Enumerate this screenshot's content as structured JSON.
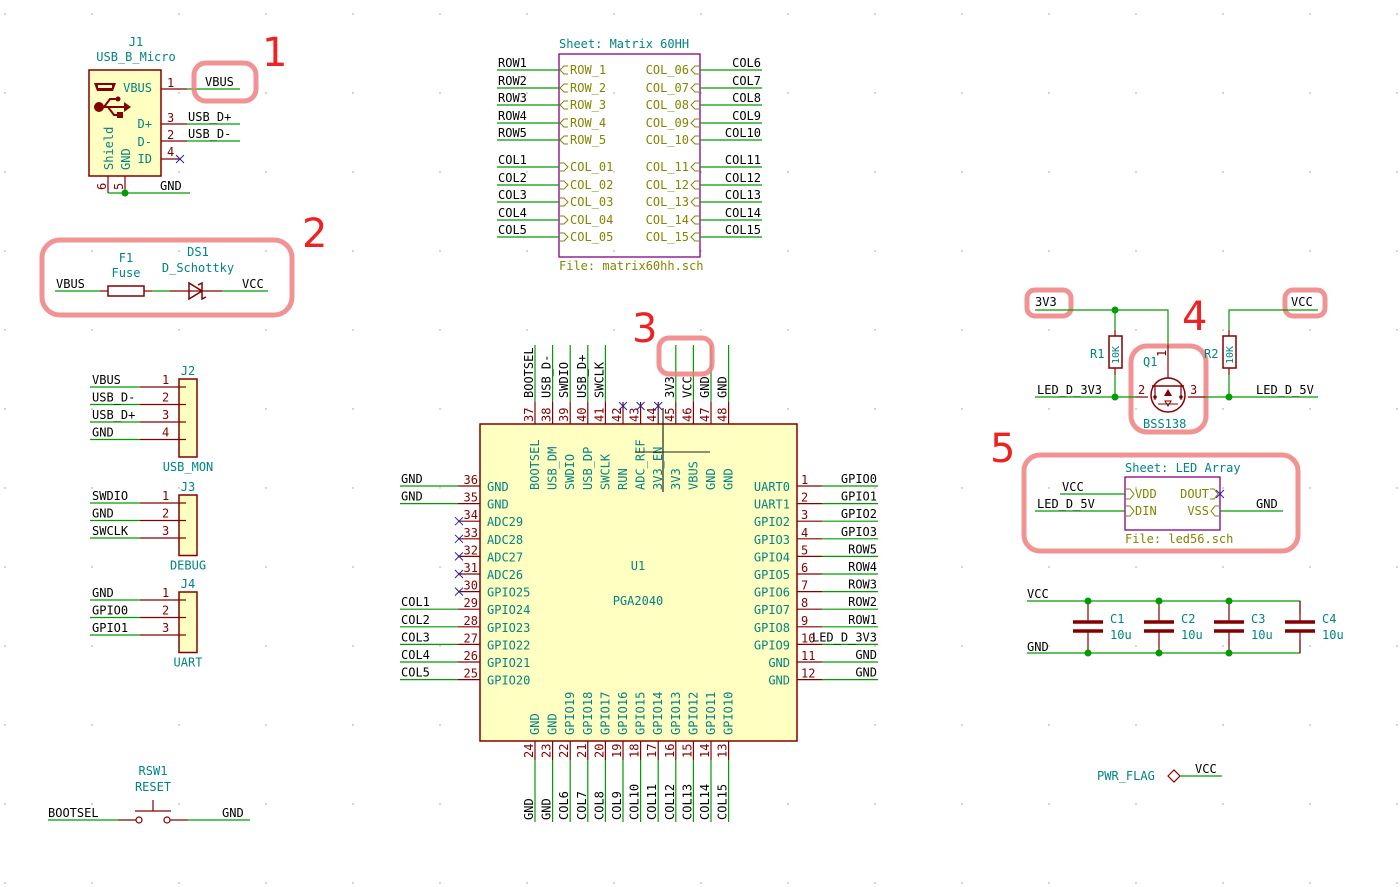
{
  "colors": {
    "wire": "#009c00",
    "component_outline": "#840000",
    "component_fill": "#ffffc2",
    "reference_text": "#008484",
    "sheet_outline": "#840084",
    "sheet_text": "#848400",
    "annotation": "#ee2222",
    "highlight": "#f08080",
    "no_connect": "#2222aa"
  },
  "annotations": [
    "1",
    "2",
    "3",
    "4",
    "5"
  ],
  "j1": {
    "ref": "J1",
    "value": "USB_B_Micro",
    "pins": [
      {
        "num": "1",
        "name": "VBUS",
        "net": "VBUS"
      },
      {
        "num": "3",
        "name": "D+",
        "net": "USB_D+"
      },
      {
        "num": "2",
        "name": "D-",
        "net": "USB_D-"
      },
      {
        "num": "4",
        "name": "ID",
        "net": ""
      }
    ],
    "shield_label": "Shield",
    "gnd_label": "GND",
    "bottom_pins": [
      "6",
      "5"
    ],
    "gnd_net": "GND",
    "icons": [
      "usb-connector-icon",
      "usb-symbol-icon"
    ]
  },
  "power_path": {
    "left_net": "VBUS",
    "right_net": "VCC",
    "fuse": {
      "ref": "F1",
      "value": "Fuse"
    },
    "diode": {
      "ref": "DS1",
      "value": "D_Schottky"
    }
  },
  "matrix_sheet": {
    "title": "Sheet: Matrix 60HH",
    "file": "File: matrix60hh.sch",
    "left_pins": [
      {
        "net": "ROW1",
        "pin": "ROW_1"
      },
      {
        "net": "ROW2",
        "pin": "ROW_2"
      },
      {
        "net": "ROW3",
        "pin": "ROW_3"
      },
      {
        "net": "ROW4",
        "pin": "ROW_4"
      },
      {
        "net": "ROW5",
        "pin": "ROW_5"
      },
      {
        "net": "COL1",
        "pin": "COL_01"
      },
      {
        "net": "COL2",
        "pin": "COL_02"
      },
      {
        "net": "COL3",
        "pin": "COL_03"
      },
      {
        "net": "COL4",
        "pin": "COL_04"
      },
      {
        "net": "COL5",
        "pin": "COL_05"
      }
    ],
    "right_pins": [
      {
        "net": "COL6",
        "pin": "COL_06"
      },
      {
        "net": "COL7",
        "pin": "COL_07"
      },
      {
        "net": "COL8",
        "pin": "COL_08"
      },
      {
        "net": "COL9",
        "pin": "COL_09"
      },
      {
        "net": "COL10",
        "pin": "COL_10"
      },
      {
        "net": "COL11",
        "pin": "COL_11"
      },
      {
        "net": "COL12",
        "pin": "COL_12"
      },
      {
        "net": "COL13",
        "pin": "COL_13"
      },
      {
        "net": "COL14",
        "pin": "COL_14"
      },
      {
        "net": "COL15",
        "pin": "COL_15"
      }
    ]
  },
  "connectors": [
    {
      "ref": "J2",
      "value": "USB_MON",
      "pins": [
        {
          "num": "1",
          "net": "VBUS"
        },
        {
          "num": "2",
          "net": "USB_D-"
        },
        {
          "num": "3",
          "net": "USB_D+"
        },
        {
          "num": "4",
          "net": "GND"
        }
      ]
    },
    {
      "ref": "J3",
      "value": "DEBUG",
      "pins": [
        {
          "num": "1",
          "net": "SWDIO"
        },
        {
          "num": "2",
          "net": "GND"
        },
        {
          "num": "3",
          "net": "SWCLK"
        }
      ]
    },
    {
      "ref": "J4",
      "value": "UART",
      "pins": [
        {
          "num": "1",
          "net": "GND"
        },
        {
          "num": "2",
          "net": "GPIO0"
        },
        {
          "num": "3",
          "net": "GPIO1"
        }
      ]
    }
  ],
  "u1": {
    "ref": "U1",
    "value": "PGA2040",
    "top_pins": [
      {
        "num": "37",
        "name": "BOOTSEL",
        "net": "BOOTSEL"
      },
      {
        "num": "38",
        "name": "USB_DM",
        "net": "USB_D-"
      },
      {
        "num": "39",
        "name": "SWDIO",
        "net": "SWDIO"
      },
      {
        "num": "40",
        "name": "USB_DP",
        "net": "USB_D+"
      },
      {
        "num": "41",
        "name": "SWCLK",
        "net": "SWCLK"
      },
      {
        "num": "42",
        "name": "RUN",
        "net": ""
      },
      {
        "num": "43",
        "name": "ADC_REF",
        "net": ""
      },
      {
        "num": "44",
        "name": "3V3_EN",
        "net": ""
      },
      {
        "num": "45",
        "name": "3V3",
        "net": "3V3"
      },
      {
        "num": "46",
        "name": "VBUS",
        "net": "VCC"
      },
      {
        "num": "47",
        "name": "GND",
        "net": "GND"
      },
      {
        "num": "48",
        "name": "GND",
        "net": "GND"
      }
    ],
    "left_pins": [
      {
        "num": "36",
        "name": "GND",
        "net": "GND"
      },
      {
        "num": "35",
        "name": "GND",
        "net": "GND"
      },
      {
        "num": "34",
        "name": "ADC29",
        "net": ""
      },
      {
        "num": "33",
        "name": "ADC28",
        "net": ""
      },
      {
        "num": "32",
        "name": "ADC27",
        "net": ""
      },
      {
        "num": "31",
        "name": "ADC26",
        "net": ""
      },
      {
        "num": "30",
        "name": "GPIO25",
        "net": ""
      },
      {
        "num": "29",
        "name": "GPIO24",
        "net": "COL1"
      },
      {
        "num": "28",
        "name": "GPIO23",
        "net": "COL2"
      },
      {
        "num": "27",
        "name": "GPIO22",
        "net": "COL3"
      },
      {
        "num": "26",
        "name": "GPIO21",
        "net": "COL4"
      },
      {
        "num": "25",
        "name": "GPIO20",
        "net": "COL5"
      }
    ],
    "right_pins": [
      {
        "num": "1",
        "name": "UART0",
        "net": "GPIO0"
      },
      {
        "num": "2",
        "name": "UART1",
        "net": "GPIO1"
      },
      {
        "num": "3",
        "name": "GPIO2",
        "net": "GPIO2"
      },
      {
        "num": "4",
        "name": "GPIO3",
        "net": "GPIO3"
      },
      {
        "num": "5",
        "name": "GPIO4",
        "net": "ROW5"
      },
      {
        "num": "6",
        "name": "GPIO5",
        "net": "ROW4"
      },
      {
        "num": "7",
        "name": "GPIO6",
        "net": "ROW3"
      },
      {
        "num": "8",
        "name": "GPIO7",
        "net": "ROW2"
      },
      {
        "num": "9",
        "name": "GPIO8",
        "net": "ROW1"
      },
      {
        "num": "10",
        "name": "GPIO9",
        "net": "LED_D_3V3"
      },
      {
        "num": "11",
        "name": "GND",
        "net": "GND"
      },
      {
        "num": "12",
        "name": "GND",
        "net": "GND"
      }
    ],
    "bottom_pins": [
      {
        "num": "24",
        "name": "GND",
        "net": "GND"
      },
      {
        "num": "23",
        "name": "GND",
        "net": "GND"
      },
      {
        "num": "22",
        "name": "GPIO19",
        "net": "COL6"
      },
      {
        "num": "21",
        "name": "GPIO18",
        "net": "COL7"
      },
      {
        "num": "20",
        "name": "GPIO17",
        "net": "COL8"
      },
      {
        "num": "19",
        "name": "GPIO16",
        "net": "COL9"
      },
      {
        "num": "18",
        "name": "GPIO15",
        "net": "COL10"
      },
      {
        "num": "17",
        "name": "GPIO14",
        "net": "COL11"
      },
      {
        "num": "16",
        "name": "GPIO13",
        "net": "COL12"
      },
      {
        "num": "15",
        "name": "GPIO12",
        "net": "COL13"
      },
      {
        "num": "14",
        "name": "GPIO11",
        "net": "COL14"
      },
      {
        "num": "13",
        "name": "GPIO10",
        "net": "COL15"
      }
    ]
  },
  "level_shifter": {
    "left_power": "3V3",
    "right_power": "VCC",
    "r1": {
      "ref": "R1",
      "value": "10K"
    },
    "r2": {
      "ref": "R2",
      "value": "10K"
    },
    "q1": {
      "ref": "Q1",
      "value": "BSS138",
      "pins": [
        "1",
        "2",
        "3"
      ]
    },
    "left_net": "LED_D_3V3",
    "right_net": "LED_D_5V"
  },
  "led_sheet": {
    "title": "Sheet: LED Array",
    "file": "File: led56.sch",
    "left_pins": [
      {
        "net": "VCC",
        "pin": "VDD"
      },
      {
        "net": "LED_D_5V",
        "pin": "DIN"
      }
    ],
    "right_pins": [
      {
        "net": "",
        "pin": "DOUT"
      },
      {
        "net": "GND",
        "pin": "VSS"
      }
    ]
  },
  "capacitors": {
    "top_net": "VCC",
    "bottom_net": "GND",
    "items": [
      {
        "ref": "C1",
        "value": "10u"
      },
      {
        "ref": "C2",
        "value": "10u"
      },
      {
        "ref": "C3",
        "value": "10u"
      },
      {
        "ref": "C4",
        "value": "10u"
      }
    ]
  },
  "reset_switch": {
    "ref": "RSW1",
    "value": "RESET",
    "left_net": "BOOTSEL",
    "right_net": "GND"
  },
  "pwr_flag": {
    "label": "PWR_FLAG",
    "net": "VCC"
  }
}
